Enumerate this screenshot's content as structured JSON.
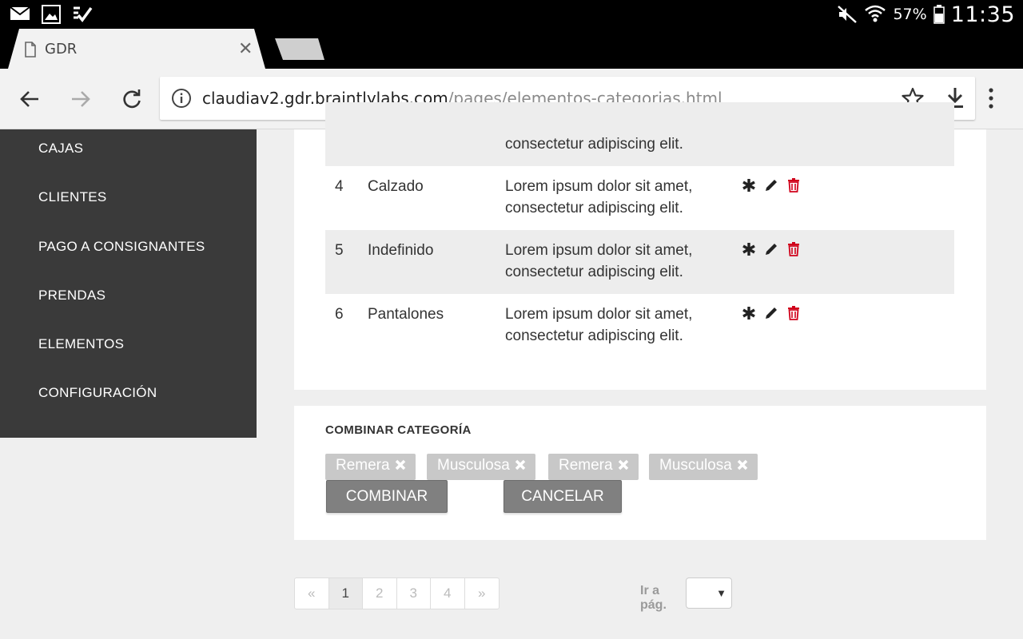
{
  "status_bar": {
    "battery": "57%",
    "time": "11:35"
  },
  "browser": {
    "tab_title": "GDR",
    "url_host": "claudiav2.gdr.braintlylabs.com",
    "url_path": "/pages/elementos-categorias.html"
  },
  "sidebar": {
    "items": [
      {
        "label": "CAJAS"
      },
      {
        "label": "CLIENTES"
      },
      {
        "label": "PAGO A CONSIGNANTES"
      },
      {
        "label": "PRENDAS"
      },
      {
        "label": "ELEMENTOS"
      },
      {
        "label": "CONFIGURACIÓN"
      }
    ]
  },
  "table": {
    "partial_row": {
      "desc_line2": "consectetur adipiscing elit."
    },
    "rows": [
      {
        "id": "4",
        "name": "Calzado",
        "desc_line1": "Lorem ipsum dolor sit amet,",
        "desc_line2": "consectetur adipiscing elit."
      },
      {
        "id": "5",
        "name": "Indefinido",
        "desc_line1": "Lorem ipsum dolor sit amet,",
        "desc_line2": "consectetur adipiscing elit."
      },
      {
        "id": "6",
        "name": "Pantalones",
        "desc_line1": "Lorem ipsum dolor sit amet,",
        "desc_line2": "consectetur adipiscing elit."
      }
    ]
  },
  "combine": {
    "title": "COMBINAR CATEGORÍA",
    "chips": [
      "Remera",
      "Musculosa",
      "Remera",
      "Musculosa"
    ],
    "combine_label": "COMBINAR",
    "cancel_label": "CANCELAR"
  },
  "pagination": {
    "prev": "«",
    "pages": [
      "1",
      "2",
      "3",
      "4"
    ],
    "next": "»",
    "current": "1",
    "goto_label": "Ir a pág."
  },
  "colors": {
    "sidebar_bg": "#3a3a3a",
    "delete_red": "#d0021b",
    "button_gray": "#808080",
    "chip_gray": "#c8c8c8"
  }
}
